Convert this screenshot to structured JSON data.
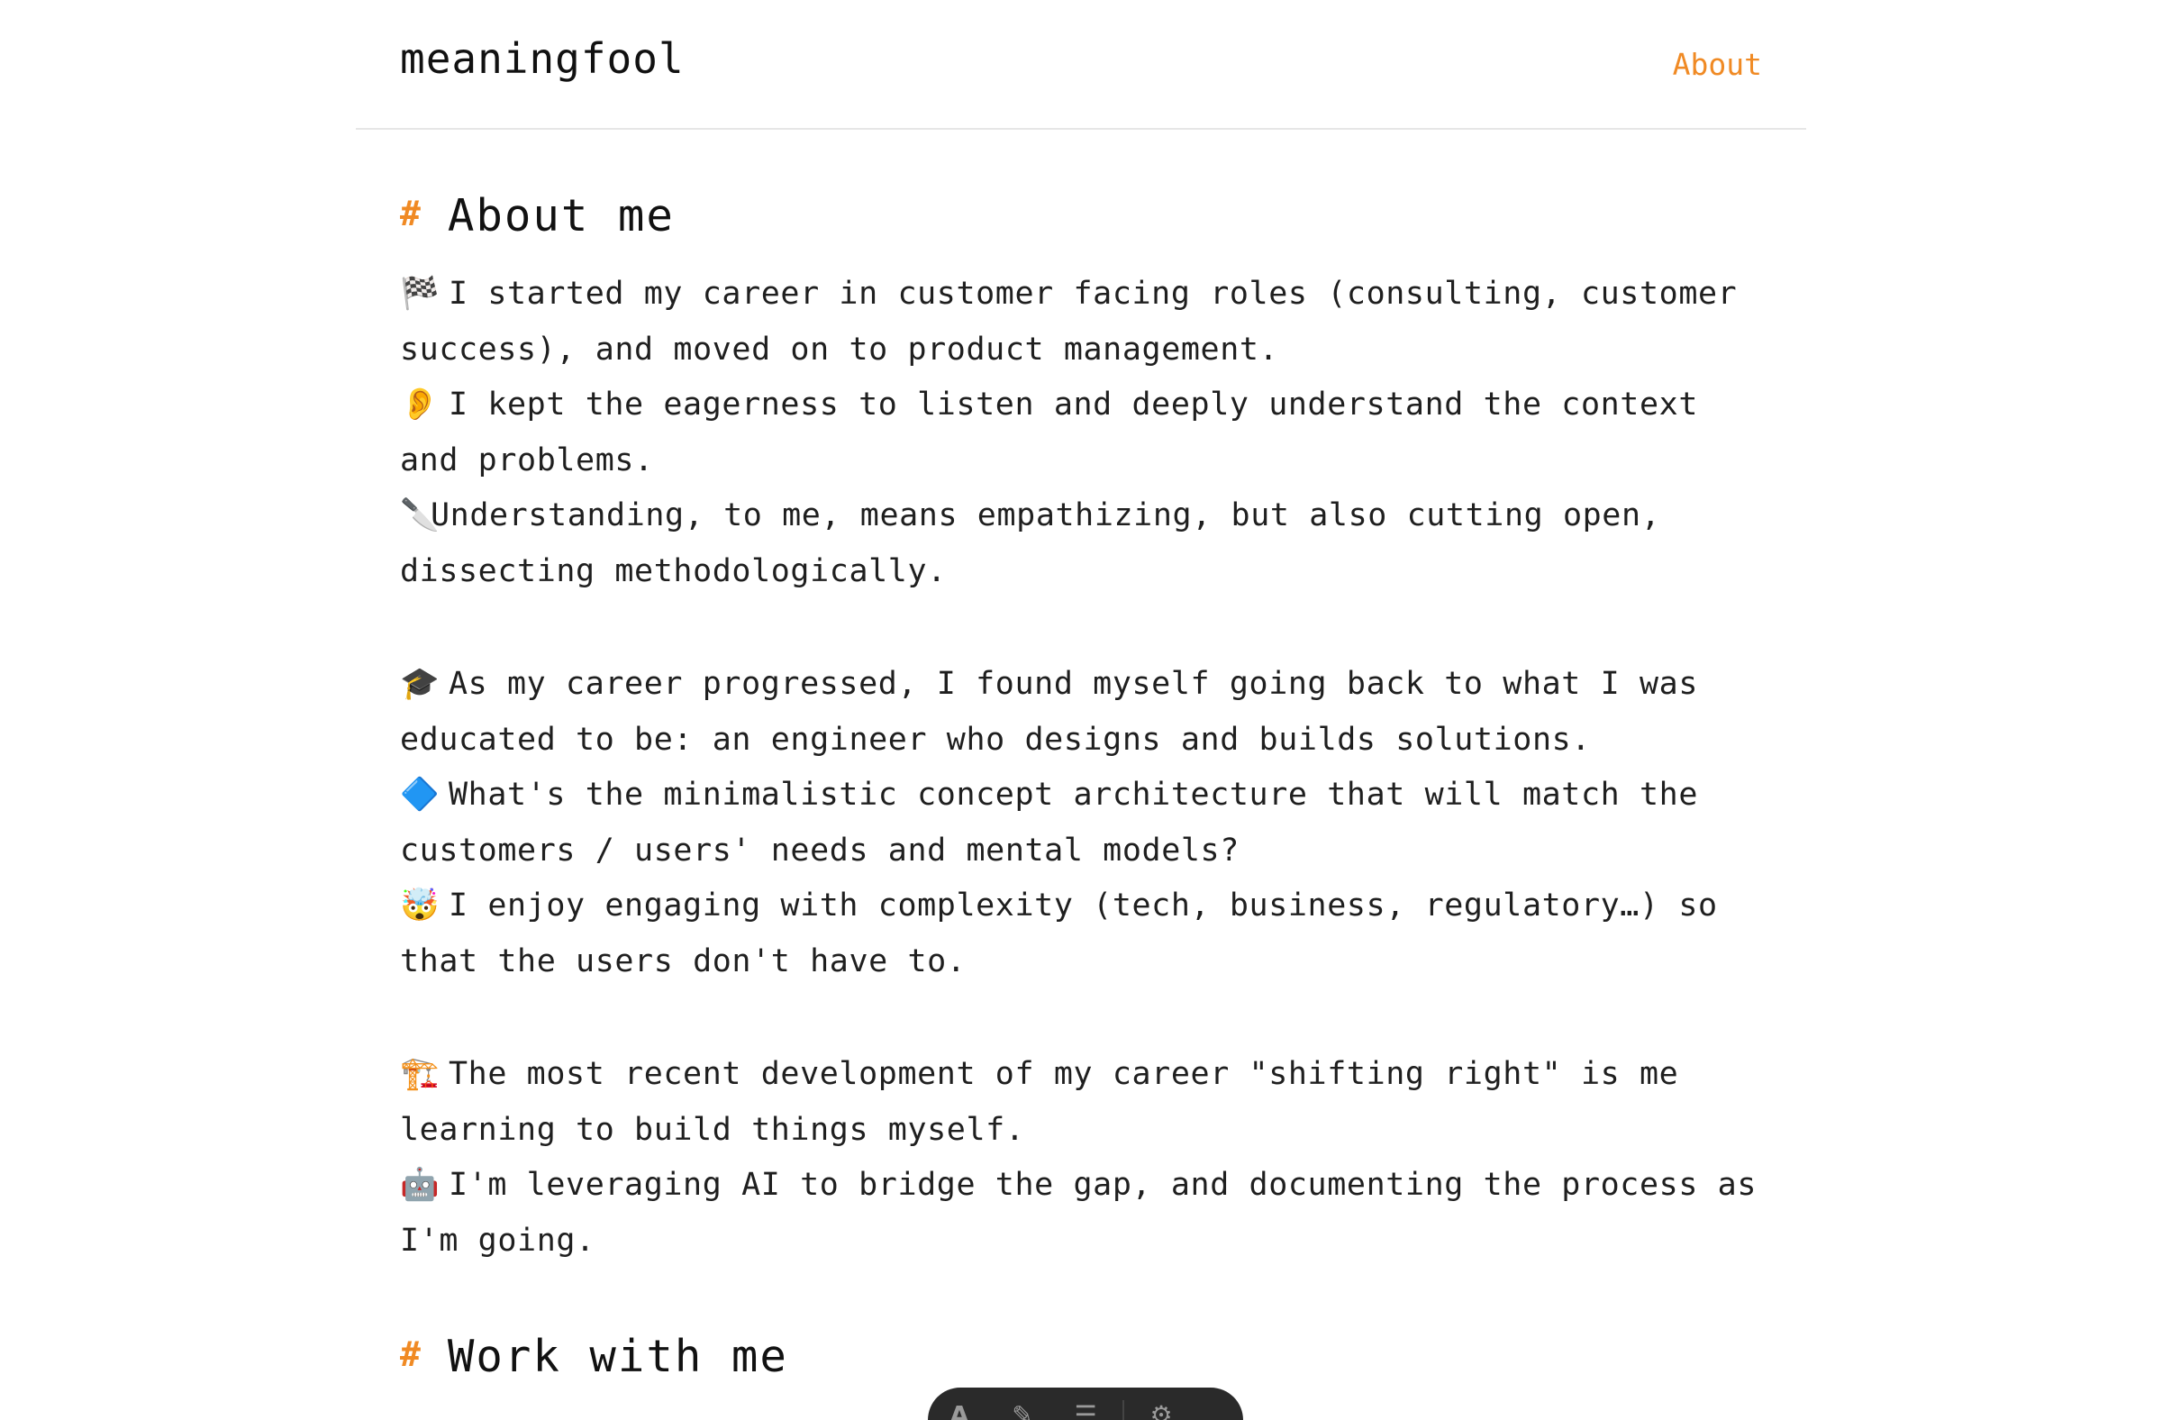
{
  "header": {
    "site_title": "meaningfool",
    "nav_about": "About"
  },
  "sections": [
    {
      "hash": "#",
      "title": "About me"
    },
    {
      "hash": "#",
      "title": "Work with me"
    }
  ],
  "about": {
    "block1": [
      {
        "emoji": "🏁",
        "text": "I started my career in customer facing roles (consulting, customer",
        "cont": "success), and moved on to product management."
      },
      {
        "emoji": "👂",
        "text": "I kept the eagerness to listen and deeply understand the context",
        "cont": "and problems."
      },
      {
        "emoji": "🔪",
        "text": "Understanding, to me, means empathizing, but also cutting open,",
        "cont": "dissecting methodologically."
      }
    ],
    "block2": [
      {
        "emoji": "🎓",
        "text": "As my career progressed, I found myself going back to what I was",
        "cont": "educated to be: an engineer who designs and builds solutions."
      },
      {
        "emoji": "🔷",
        "text": "What's the minimalistic concept architecture that will match the",
        "cont": "customers / users' needs and mental models?"
      },
      {
        "emoji": "🤯",
        "text": "I enjoy engaging with complexity (tech, business, regulatory…) so",
        "cont": "that the users don't have to."
      }
    ],
    "block3": [
      {
        "emoji": "🏗️",
        "text": "The most recent development of my career \"shifting right\" is me",
        "cont": "learning to build things myself."
      },
      {
        "emoji": "🤖",
        "text": "I'm leveraging AI to bridge the gap, and documenting the process as",
        "cont": "I'm going."
      }
    ]
  },
  "toolbar": {
    "icons": [
      "text-icon",
      "pen-icon",
      "list-icon",
      "settings-icon"
    ],
    "glyphs": [
      "A",
      "✎",
      "☰",
      "⚙"
    ]
  },
  "colors": {
    "accent": "#f08a24",
    "text": "#1f1f1f",
    "divider": "#e6e6e6"
  }
}
